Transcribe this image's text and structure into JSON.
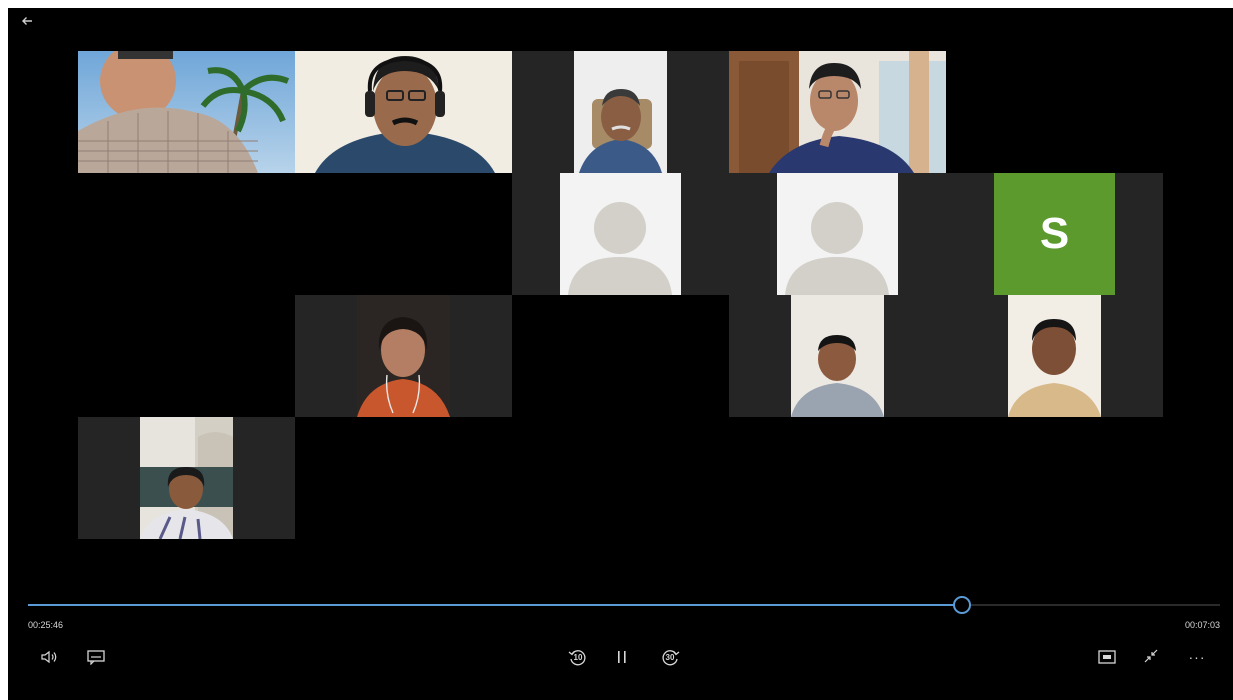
{
  "player": {
    "elapsed": "00:25:46",
    "remaining": "00:07:03",
    "progress": 0.783,
    "controls": {
      "back": "back-arrow-icon",
      "volume": "volume-icon",
      "subtitles": "subtitles-icon",
      "rewind": "rewind-10-icon",
      "rewind_label": "10",
      "play_pause": "pause-icon",
      "forward": "forward-30-icon",
      "forward_label": "30",
      "mini_view": "mini-view-icon",
      "exit_fullscreen": "exit-fullscreen-icon",
      "more": "more-icon",
      "more_label": "···"
    }
  },
  "participants": [
    {
      "type": "video",
      "scene": "outdoor-palm"
    },
    {
      "type": "video",
      "scene": "headset-man"
    },
    {
      "type": "video",
      "scene": "office-chair"
    },
    {
      "type": "video",
      "scene": "door-room"
    },
    {
      "type": "avatar",
      "icon": "default-avatar-icon"
    },
    {
      "type": "avatar",
      "icon": "default-avatar-icon"
    },
    {
      "type": "initial",
      "initial": "S",
      "color": "#5c9a2e"
    },
    {
      "type": "video",
      "scene": "woman-earphones"
    },
    {
      "type": "video",
      "scene": "man-wall"
    },
    {
      "type": "video",
      "scene": "man-room"
    },
    {
      "type": "video",
      "scene": "woman-arch"
    }
  ]
}
